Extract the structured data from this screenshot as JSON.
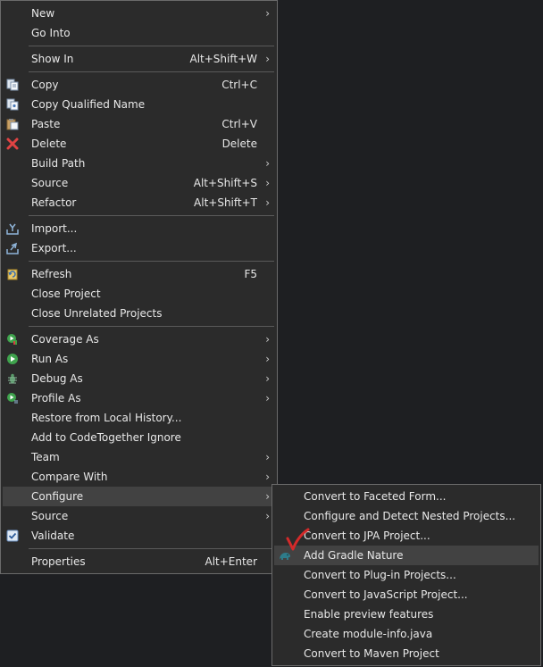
{
  "context_menu": {
    "new": "New",
    "go_into": "Go Into",
    "show_in": "Show In",
    "show_in_accel": "Alt+Shift+W",
    "copy": "Copy",
    "copy_accel": "Ctrl+C",
    "copy_qualified": "Copy Qualified Name",
    "paste": "Paste",
    "paste_accel": "Ctrl+V",
    "delete": "Delete",
    "delete_accel": "Delete",
    "build_path": "Build Path",
    "source": "Source",
    "source_accel": "Alt+Shift+S",
    "refactor": "Refactor",
    "refactor_accel": "Alt+Shift+T",
    "import": "Import...",
    "export": "Export...",
    "refresh": "Refresh",
    "refresh_accel": "F5",
    "close_project": "Close Project",
    "close_unrelated": "Close Unrelated Projects",
    "coverage_as": "Coverage As",
    "run_as": "Run As",
    "debug_as": "Debug As",
    "profile_as": "Profile As",
    "restore_history": "Restore from Local History...",
    "add_codetogether": "Add to CodeTogether Ignore",
    "team": "Team",
    "compare_with": "Compare With",
    "configure": "Configure",
    "source2": "Source",
    "validate": "Validate",
    "properties": "Properties",
    "properties_accel": "Alt+Enter",
    "arrow": "›"
  },
  "configure_submenu": {
    "faceted_form": "Convert to Faceted Form...",
    "nested_projects": "Configure and Detect Nested Projects...",
    "jpa_project": "Convert to JPA Project...",
    "gradle_nature": "Add Gradle Nature",
    "plugin_projects": "Convert to Plug-in Projects...",
    "javascript_project": "Convert to JavaScript Project...",
    "preview_features": "Enable preview features",
    "module_info": "Create module-info.java",
    "maven_project": "Convert to Maven Project"
  },
  "colors": {
    "menu_bg": "#2b2b2b",
    "highlight": "#424242",
    "annotation_red": "#d42a2a"
  }
}
